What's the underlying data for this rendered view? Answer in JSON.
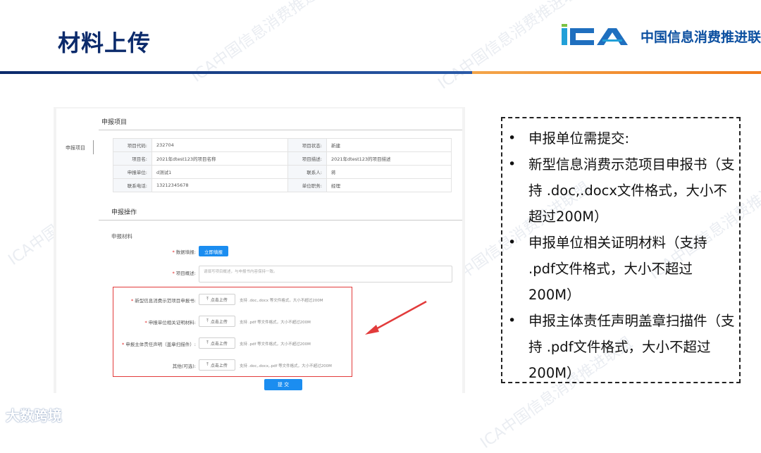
{
  "slide": {
    "title": "材料上传"
  },
  "logo": {
    "mark_text": "ICA",
    "org_name": "中国信息消费推进联盟"
  },
  "watermark": {
    "text": "ICA中国信息消费推进联盟"
  },
  "form": {
    "sidebar_label": "申报项目",
    "section_project": "申报项目",
    "info": [
      {
        "k1": "项目代码:",
        "v1": "232704",
        "k2": "项目状态:",
        "v2": "新建"
      },
      {
        "k1": "项目名:",
        "v1": "2021年dtest123的项目名称",
        "k2": "项目描述:",
        "v2": "2021年dtest123的项目描述"
      },
      {
        "k1": "申报单位:",
        "v1": "d测试1",
        "k2": "联系人:",
        "v2": "蒋"
      },
      {
        "k1": "联系电话:",
        "v1": "13212345678",
        "k2": "单位职务:",
        "v2": "经理"
      }
    ],
    "section_operation": "申报操作",
    "materials_title": "申报材料",
    "data_fill_label": "数据填报:",
    "data_fill_button": "立即填报",
    "desc_label": "项目概述:",
    "desc_placeholder": "请填写项目概述，与申报书内容保持一致。",
    "uploads": [
      {
        "label": "新型信息消费示范项目申报书:",
        "required": true,
        "button": "点击上传",
        "hint": "支持 .doc,.docx 等文件格式，大小不超过200M"
      },
      {
        "label": "申报单位相关证明材料:",
        "required": true,
        "button": "点击上传",
        "hint": "支持 .pdf 等文件格式，大小不超过200M"
      },
      {
        "label": "申报主体责任声明（盖章扫描件）:",
        "required": true,
        "button": "点击上传",
        "hint": "支持 .pdf 等文件格式，大小不超过200M"
      },
      {
        "label": "其他(可选):",
        "required": false,
        "button": "点击上传",
        "hint": "支持 .doc,.docx,.pdf 等文件格式，大小不超过200M"
      }
    ],
    "required_mark": "*",
    "submit_label": "提 交"
  },
  "requirements": {
    "items": [
      {
        "bullet": "•",
        "text": "申报单位需提交:"
      },
      {
        "bullet": "•",
        "text": "新型信息消费示范项目申报书（支持 .doc,.docx文件格式，大小不超过200M）"
      },
      {
        "bullet": "•",
        "text": "申报单位相关证明材料（支持 .pdf文件格式，大小不超过200M）"
      },
      {
        "bullet": "•",
        "text": "申报主体责任声明盖章扫描件（支持 .pdf文件格式，大小不超过200M）"
      }
    ]
  },
  "footer": {
    "brand": "大数跨境"
  },
  "colors": {
    "title": "#0b2a6b",
    "accent_orange": "#f07a1a",
    "highlight_red": "#e23b3b",
    "primary_blue": "#1b8df0"
  }
}
